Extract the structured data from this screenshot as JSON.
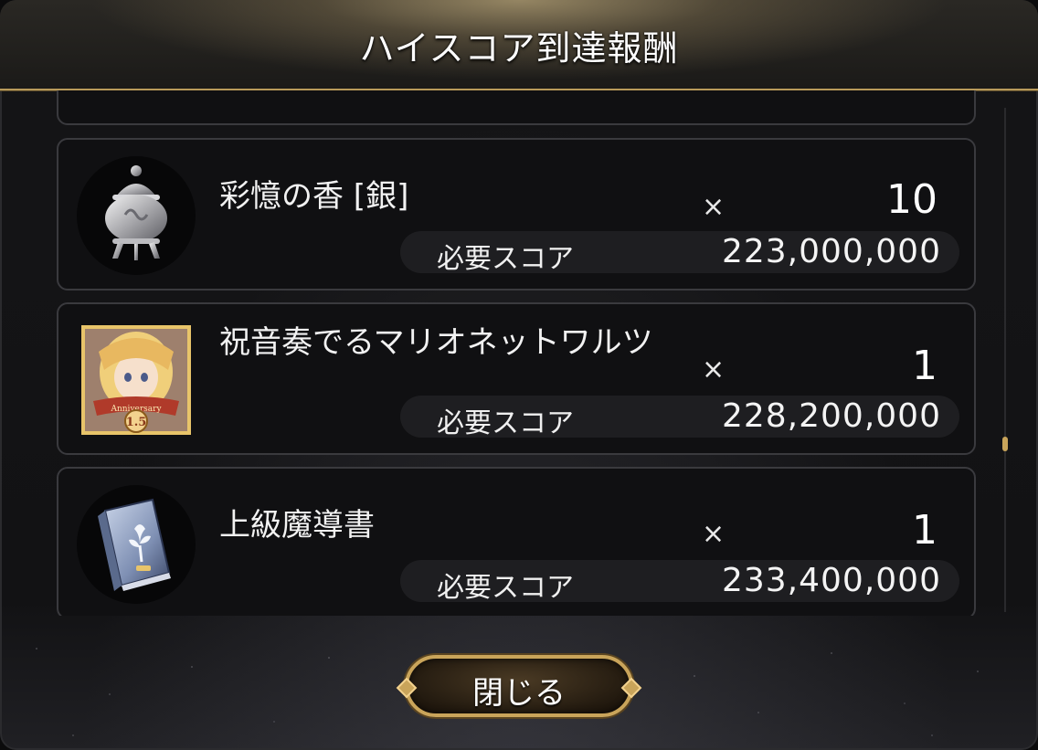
{
  "dialog": {
    "title": "ハイスコア到達報酬",
    "close_label": "閉じる"
  },
  "rewards": [
    {
      "name": "彩憶の香 [銀]",
      "icon": "silver-incense-burner-icon",
      "times": "×",
      "quantity": "10",
      "score_label": "必要スコア",
      "score_value": "223,000,000"
    },
    {
      "name": "祝音奏でるマリオネットワルツ",
      "icon": "anniversary-card-portrait-icon",
      "card_badge": "1.5",
      "times": "×",
      "quantity": "1",
      "score_label": "必要スコア",
      "score_value": "228,200,000"
    },
    {
      "name": "上級魔導書",
      "icon": "advanced-grimoire-book-icon",
      "times": "×",
      "quantity": "1",
      "score_label": "必要スコア",
      "score_value": "233,400,000"
    }
  ],
  "scroll": {
    "position_fraction": 0.65
  },
  "colors": {
    "accent_gold": "#c9a45a",
    "card_bg": "#101012",
    "score_bar_bg": "#1e1e21"
  }
}
